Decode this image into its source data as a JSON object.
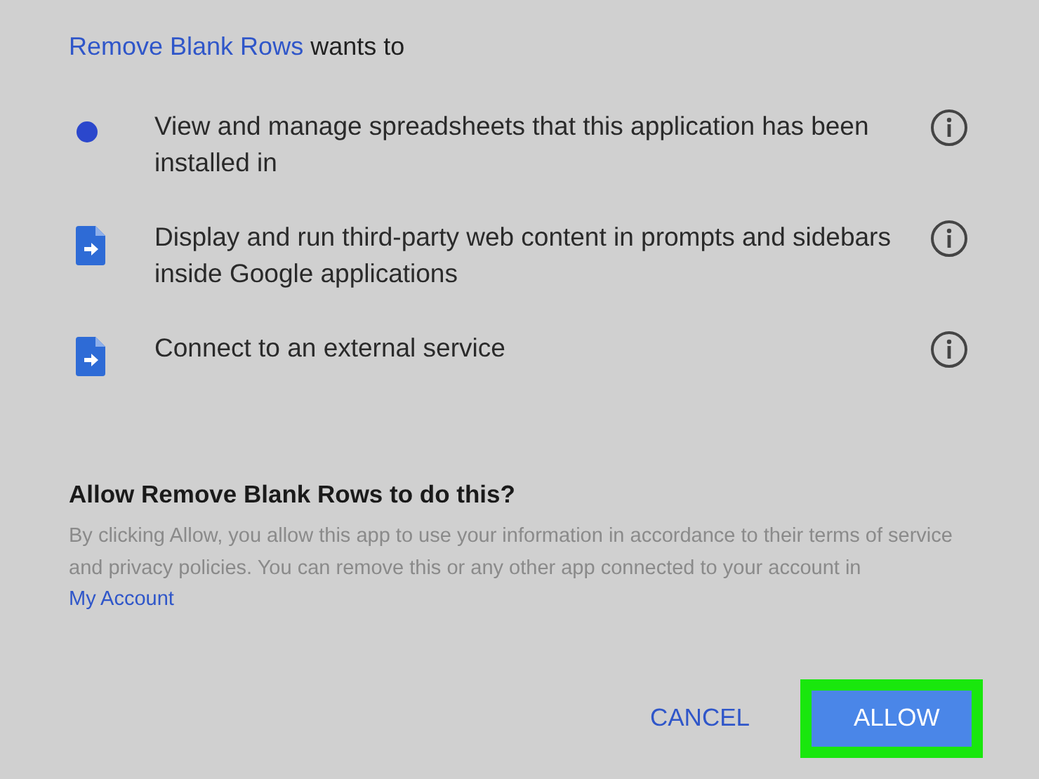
{
  "heading": {
    "app_name": "Remove Blank Rows",
    "suffix": "wants to"
  },
  "permissions": [
    {
      "kind": "dot",
      "text": "View and manage spreadsheets that this application has been installed in"
    },
    {
      "kind": "doc",
      "text": "Display and run third-party web content in prompts and sidebars inside Google applications"
    },
    {
      "kind": "doc",
      "text": "Connect to an external service"
    }
  ],
  "consent": {
    "title": "Allow Remove Blank Rows to do this?",
    "text": "By clicking Allow, you allow this app to use your information in accordance to their terms of service and privacy policies. You can remove this or any other app connected to your account in",
    "link": "My Account"
  },
  "buttons": [
    {
      "kind": "text",
      "label": "CANCEL",
      "highlighted": false
    },
    {
      "kind": "filled",
      "label": "ALLOW",
      "highlighted": true
    }
  ]
}
